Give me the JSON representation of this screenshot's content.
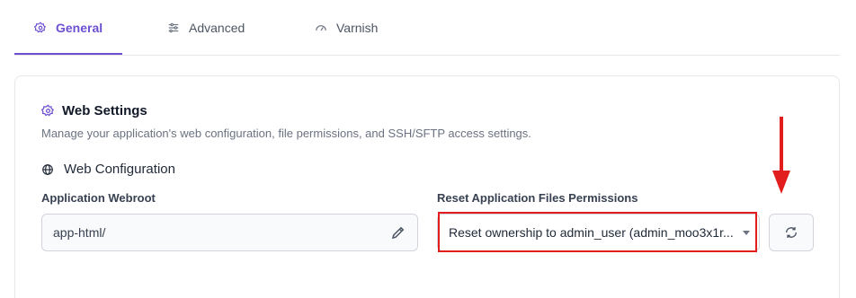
{
  "tabs": [
    {
      "label": "General",
      "icon": "gear-icon",
      "active": true
    },
    {
      "label": "Advanced",
      "icon": "sliders-icon",
      "active": false
    },
    {
      "label": "Varnish",
      "icon": "speedometer-icon",
      "active": false
    }
  ],
  "card": {
    "title": "Web Settings",
    "description": "Manage your application's web configuration, file permissions, and SSH/SFTP access settings.",
    "section_title": "Web Configuration"
  },
  "webroot": {
    "label": "Application Webroot",
    "value": "app-html/"
  },
  "reset_permissions": {
    "label": "Reset Application Files Permissions",
    "selected": "Reset ownership to admin_user (admin_moo3x1r..."
  },
  "colors": {
    "accent": "#6d4fd1",
    "annotation": "#e11d1d"
  }
}
